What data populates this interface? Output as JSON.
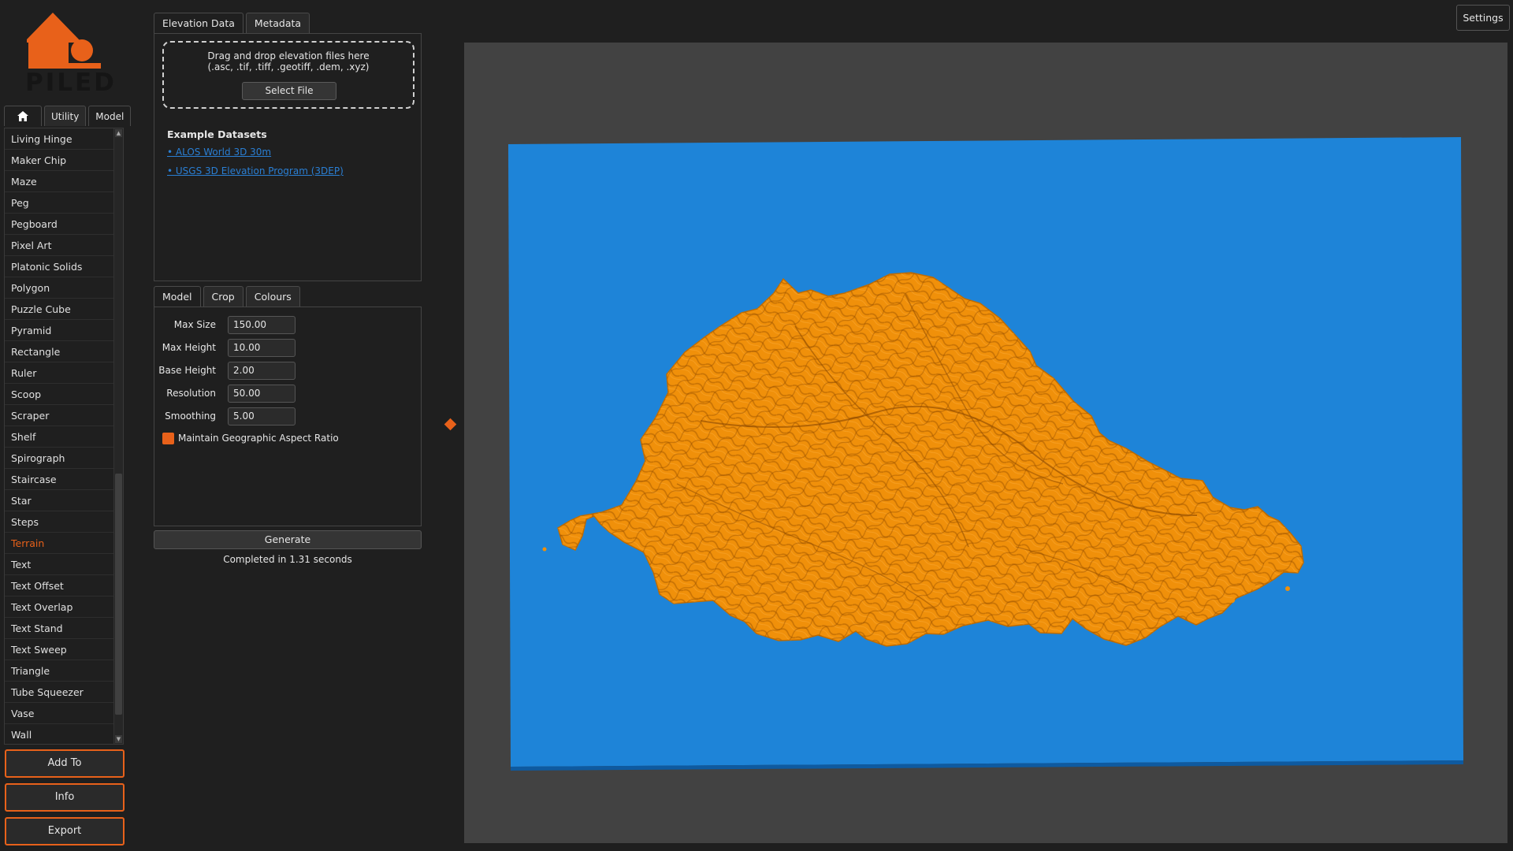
{
  "logo": {
    "text": "PILED",
    "brand_color": "#e8611a"
  },
  "nav": {
    "tabs": [
      {
        "label": "",
        "icon": "home-icon"
      },
      {
        "label": "Utility"
      },
      {
        "label": "Model"
      }
    ],
    "items": [
      "Living Hinge",
      "Maker Chip",
      "Maze",
      "Peg",
      "Pegboard",
      "Pixel Art",
      "Platonic Solids",
      "Polygon",
      "Puzzle Cube",
      "Pyramid",
      "Rectangle",
      "Ruler",
      "Scoop",
      "Scraper",
      "Shelf",
      "Spirograph",
      "Staircase",
      "Star",
      "Steps",
      "Terrain",
      "Text",
      "Text Offset",
      "Text Overlap",
      "Text Stand",
      "Text Sweep",
      "Triangle",
      "Tube Squeezer",
      "Vase",
      "Wall"
    ],
    "selected": "Terrain"
  },
  "actions": {
    "add_to": "Add To",
    "info": "Info",
    "export": "Export"
  },
  "source_tabs": {
    "elevation": "Elevation Data",
    "metadata": "Metadata"
  },
  "dropzone": {
    "line1": "Drag and drop elevation files here",
    "line2": "(.asc, .tif, .tiff, .geotiff, .dem, .xyz)",
    "select_file": "Select File"
  },
  "datasets": {
    "title": "Example Datasets",
    "links": [
      "• ALOS World 3D 30m",
      "• USGS 3D Elevation Program (3DEP)"
    ]
  },
  "param_tabs": {
    "model": "Model",
    "crop": "Crop",
    "colours": "Colours"
  },
  "params": {
    "max_size": {
      "label": "Max Size",
      "value": "150.00"
    },
    "max_height": {
      "label": "Max Height",
      "value": "10.00"
    },
    "base_height": {
      "label": "Base Height",
      "value": "2.00"
    },
    "resolution": {
      "label": "Resolution",
      "value": "50.00"
    },
    "smoothing": {
      "label": "Smoothing",
      "value": "5.00"
    }
  },
  "aspect_ratio": {
    "label": "Maintain Geographic Aspect Ratio",
    "checked": true
  },
  "generate": {
    "label": "Generate"
  },
  "status": "Completed in 1.31 seconds",
  "settings": {
    "label": "Settings"
  },
  "viewport": {
    "background_color": "#424242",
    "base_plate_color": "#1e84d8",
    "terrain_color": "#f0900a"
  }
}
